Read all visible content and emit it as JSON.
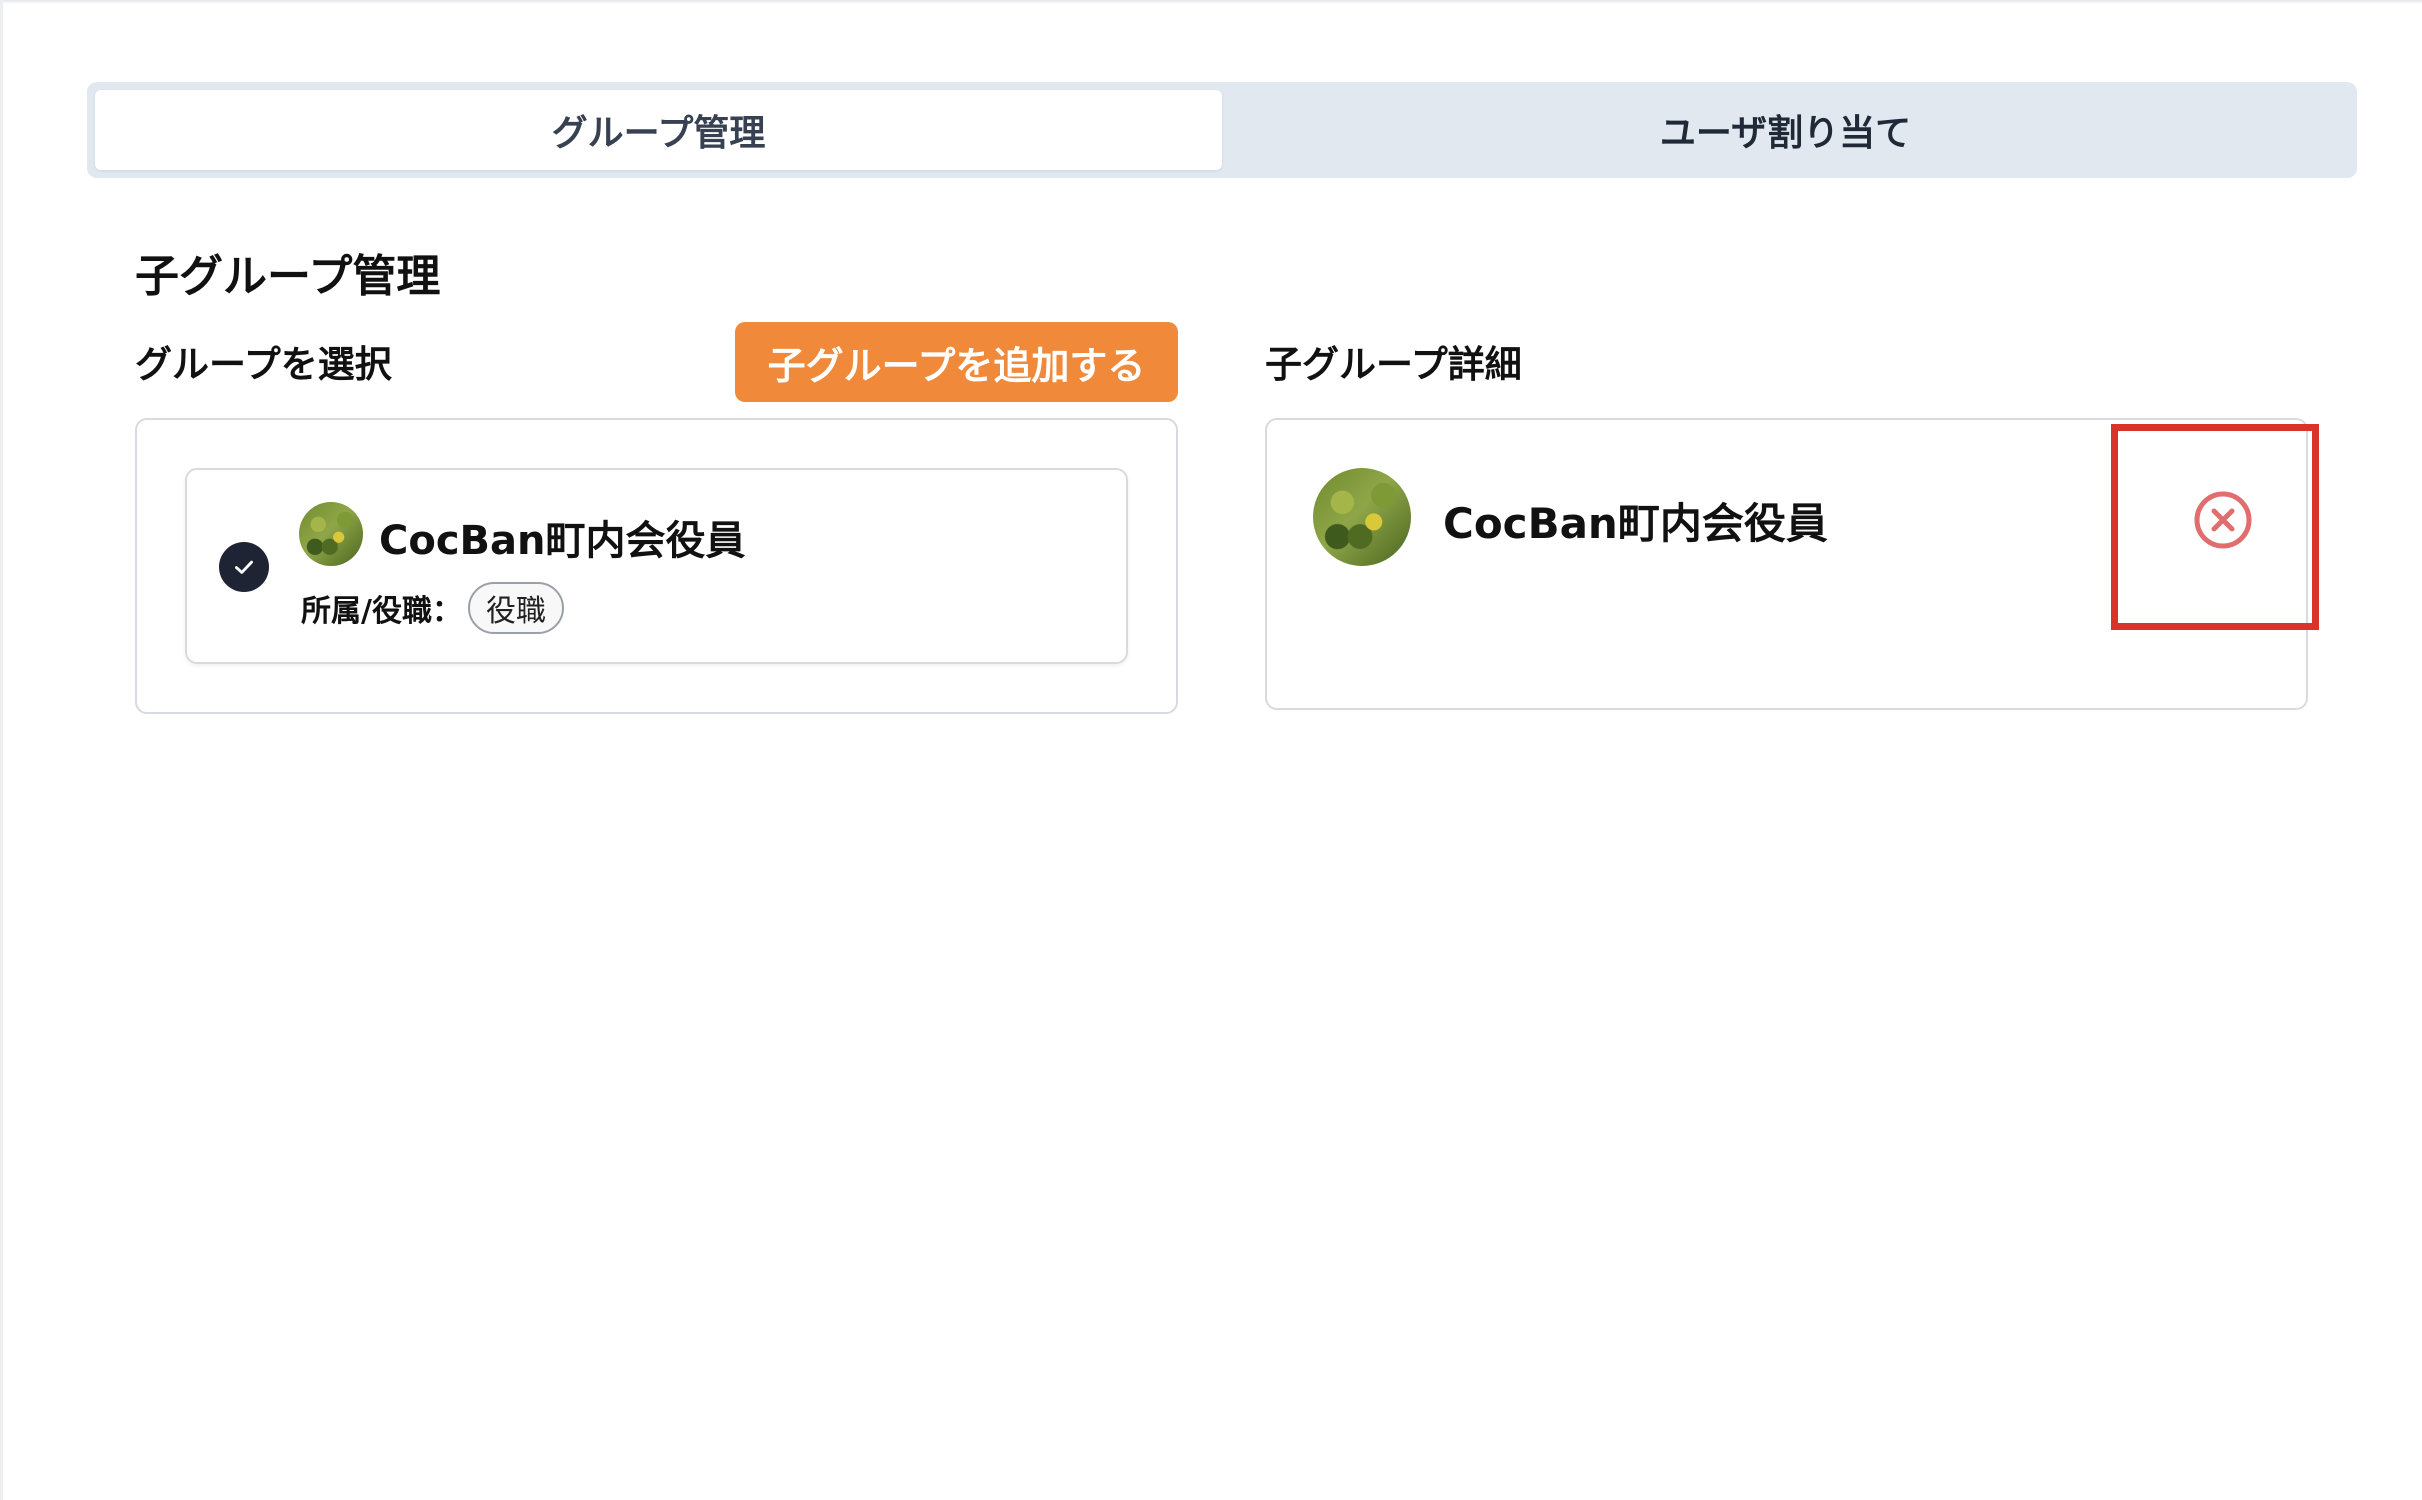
{
  "tabs": [
    {
      "label": "グループ管理",
      "active": true
    },
    {
      "label": "ユーザ割り当て",
      "active": false
    }
  ],
  "section": {
    "title": "子グループ管理"
  },
  "left": {
    "label": "グループを選択",
    "add_button_label": "子グループを追加する",
    "groups": [
      {
        "name": "CocBan町内会役員",
        "role_label": "所属/役職：",
        "role_badge": "役職",
        "selected": true
      }
    ]
  },
  "right": {
    "label": "子グループ詳細",
    "detail_name": "CocBan町内会役員",
    "remove_icon": "circle-x-icon"
  },
  "colors": {
    "accent": "#f08a3a",
    "highlight": "#d8352a",
    "remove_icon": "#e06e6e",
    "tab_bg": "#e2e8f0"
  }
}
